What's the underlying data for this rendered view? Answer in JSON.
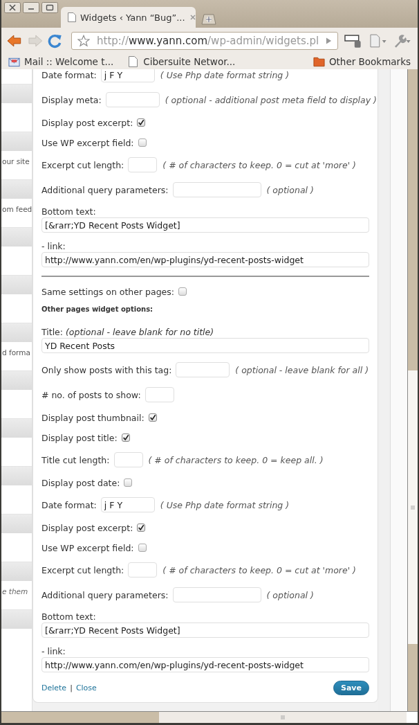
{
  "browser": {
    "tab": {
      "title": "Widgets ‹ Yann “Bug”..."
    },
    "address": {
      "scheme": "http://",
      "host": "www.yann.com",
      "path": "/wp-admin/widgets.pl"
    },
    "bookmarks": [
      {
        "label": "Mail :: Welcome t...",
        "kind": "mail"
      },
      {
        "label": "Cibersuite Networ...",
        "kind": "page"
      }
    ],
    "other_bookmarks": "Other Bookmarks"
  },
  "sidebar": {
    "sections": [
      {
        "kind": "empty"
      },
      {
        "text": "our site",
        "kind": "plain"
      },
      {
        "text": "om feed",
        "kind": "plain"
      },
      {
        "kind": "empty"
      },
      {
        "kind": "empty"
      },
      {
        "text": "d forma",
        "kind": "plain"
      },
      {
        "kind": "empty"
      },
      {
        "kind": "empty"
      },
      {
        "kind": "empty"
      },
      {
        "kind": "empty"
      },
      {
        "text": "e them",
        "kind": "italic"
      },
      {
        "kind": "empty"
      }
    ]
  },
  "widget": {
    "rows": [
      {
        "kind": "field",
        "label": "Date format:",
        "value": "j F Y",
        "hint": "( Use Php date format string )"
      },
      {
        "kind": "field",
        "label": "Display meta:",
        "value": "",
        "hint": "( optional - additional post meta field to display )"
      },
      {
        "kind": "checkbox",
        "label": "Display post excerpt:",
        "checked": true
      },
      {
        "kind": "checkbox",
        "label": "Use WP excerpt field:",
        "checked": false
      },
      {
        "kind": "number-field",
        "label": "Excerpt cut length:",
        "value": "",
        "hint": "( # of characters to keep. 0 = cut at 'more' )"
      },
      {
        "kind": "long-field",
        "label": "Additional query parameters:",
        "value": "",
        "hint": "( optional )"
      },
      {
        "kind": "block-field",
        "label": "Bottom text:",
        "value": "[&rarr;YD Recent Posts Widget]"
      },
      {
        "kind": "block-field",
        "label": "- link:",
        "value": "http://www.yann.com/en/wp-plugins/yd-recent-posts-widget"
      },
      {
        "kind": "divider"
      },
      {
        "kind": "checkbox",
        "label": "Same settings on other pages:",
        "checked": false
      },
      {
        "kind": "heading",
        "label": "Other pages widget options:"
      },
      {
        "kind": "title-field",
        "label": "Title:",
        "hint": "(optional - leave blank for no title)",
        "value": "YD Recent Posts"
      },
      {
        "kind": "field",
        "label": "Only show posts with this tag:",
        "value": "",
        "hint": "( optional - leave blank for all )"
      },
      {
        "kind": "number-field",
        "label": "# no. of posts to show:",
        "value": ""
      },
      {
        "kind": "checkbox",
        "label": "Display post thumbnail:",
        "checked": true
      },
      {
        "kind": "checkbox",
        "label": "Display post title:",
        "checked": true
      },
      {
        "kind": "number-field",
        "label": "Title cut length:",
        "value": "",
        "hint": "( # of characters to keep. 0 = keep all. )"
      },
      {
        "kind": "checkbox",
        "label": "Display post date:",
        "checked": false
      },
      {
        "kind": "field",
        "label": "Date format:",
        "value": "j F Y",
        "hint": "( Use Php date format string )"
      },
      {
        "kind": "checkbox",
        "label": "Display post excerpt:",
        "checked": true
      },
      {
        "kind": "checkbox",
        "label": "Use WP excerpt field:",
        "checked": false
      },
      {
        "kind": "number-field",
        "label": "Excerpt cut length:",
        "value": "",
        "hint": "( # of characters to keep. 0 = cut at 'more' )"
      },
      {
        "kind": "long-field",
        "label": "Additional query parameters:",
        "value": "",
        "hint": "( optional )"
      },
      {
        "kind": "block-field",
        "label": "Bottom text:",
        "value": "[&rarr;YD Recent Posts Widget]"
      },
      {
        "kind": "block-field",
        "label": "- link:",
        "value": "http://www.yann.com/en/wp-plugins/yd-recent-posts-widget"
      }
    ],
    "actions": {
      "delete": "Delete",
      "separator": "|",
      "close": "Close",
      "save": "Save"
    }
  }
}
